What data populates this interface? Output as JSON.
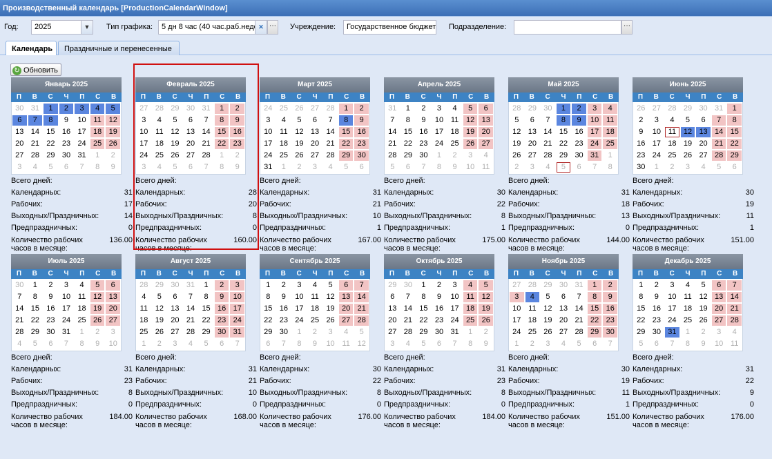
{
  "window": {
    "title": "Производственный календарь [ProductionCalendarWindow]"
  },
  "toolbar": {
    "year_label": "Год:",
    "year_value": "2025",
    "schedule_label": "Тип графика:",
    "schedule_value": "5 дн 8 час (40 час.раб.неде",
    "institution_label": "Учреждение:",
    "institution_value": "Государственное бюджет",
    "division_label": "Подразделение:",
    "division_value": ""
  },
  "tabs": [
    {
      "label": "Календарь",
      "active": true
    },
    {
      "label": "Праздничные и перенесенные дни",
      "active": false
    }
  ],
  "refresh_label": "Обновить",
  "weekdays": [
    "П",
    "В",
    "С",
    "Ч",
    "П",
    "С",
    "В"
  ],
  "stat_labels": {
    "total": "Всего дней:",
    "calendar": "Календарных:",
    "work": "Рабочих:",
    "off": "Выходных/Праздничных:",
    "pre": "Предпраздничных:",
    "hours": "Количество рабочих часов в месяце:"
  },
  "colors": {
    "weekend": "#f2c4c4",
    "selected": "#5b86df",
    "header": "#3d83c4",
    "pre_holiday_border": "#b32b2b"
  },
  "months": [
    {
      "name": "Январь 2025",
      "lead": 2,
      "prev_end": 31,
      "days": 31,
      "weekend": [
        1,
        2,
        3,
        4,
        5,
        6,
        7,
        8,
        11,
        12,
        18,
        19,
        25,
        26
      ],
      "selected": [
        1,
        2,
        3,
        4,
        5,
        6,
        7,
        8
      ],
      "pre": [],
      "calendar": 31,
      "work": 17,
      "off": 14,
      "pre_count": 0,
      "hours": "136.00"
    },
    {
      "name": "Февраль 2025",
      "lead": 5,
      "prev_end": 31,
      "days": 28,
      "weekend": [
        1,
        2,
        8,
        9,
        15,
        16,
        22,
        23
      ],
      "selected": [],
      "pre": [],
      "calendar": 28,
      "work": 20,
      "off": 8,
      "pre_count": 0,
      "hours": "160.00"
    },
    {
      "name": "Март 2025",
      "lead": 5,
      "prev_end": 28,
      "days": 31,
      "weekend": [
        1,
        2,
        8,
        9,
        15,
        16,
        22,
        23,
        29,
        30
      ],
      "selected": [
        8
      ],
      "pre": [],
      "calendar": 31,
      "work": 21,
      "off": 10,
      "pre_count": 1,
      "hours": "167.00"
    },
    {
      "name": "Апрель 2025",
      "lead": 1,
      "prev_end": 31,
      "days": 30,
      "weekend": [
        5,
        6,
        12,
        13,
        19,
        20,
        26,
        27
      ],
      "selected": [],
      "pre": [],
      "calendar": 30,
      "work": 22,
      "off": 8,
      "pre_count": 1,
      "hours": "175.00"
    },
    {
      "name": "Май 2025",
      "lead": 3,
      "prev_end": 30,
      "days": 31,
      "weekend": [
        3,
        4,
        10,
        11,
        17,
        18,
        24,
        25,
        31
      ],
      "selected": [
        1,
        2,
        8,
        9
      ],
      "pre": [],
      "calendar": 31,
      "work": 18,
      "off": 13,
      "pre_count": 0,
      "hours": "144.00"
    },
    {
      "name": "Июнь 2025",
      "lead": 6,
      "prev_end": 31,
      "days": 30,
      "weekend": [
        1,
        7,
        8,
        14,
        15,
        21,
        22,
        28,
        29
      ],
      "selected": [
        12,
        13
      ],
      "pre": [
        11
      ],
      "calendar": 30,
      "work": 19,
      "off": 11,
      "pre_count": 1,
      "hours": "151.00"
    },
    {
      "name": "Июль 2025",
      "lead": 1,
      "prev_end": 30,
      "days": 31,
      "weekend": [
        5,
        6,
        12,
        13,
        19,
        20,
        26,
        27
      ],
      "selected": [],
      "pre": [],
      "calendar": 31,
      "work": 23,
      "off": 8,
      "pre_count": 0,
      "hours": "184.00"
    },
    {
      "name": "Август 2025",
      "lead": 4,
      "prev_end": 31,
      "days": 31,
      "weekend": [
        2,
        3,
        9,
        10,
        16,
        17,
        23,
        24,
        30,
        31
      ],
      "selected": [],
      "pre": [],
      "calendar": 31,
      "work": 21,
      "off": 10,
      "pre_count": 0,
      "hours": "168.00"
    },
    {
      "name": "Сентябрь 2025",
      "lead": 0,
      "prev_end": 31,
      "days": 30,
      "weekend": [
        6,
        7,
        13,
        14,
        20,
        21,
        27,
        28
      ],
      "selected": [],
      "pre": [],
      "calendar": 30,
      "work": 22,
      "off": 8,
      "pre_count": 0,
      "hours": "176.00"
    },
    {
      "name": "Октябрь 2025",
      "lead": 2,
      "prev_end": 30,
      "days": 31,
      "weekend": [
        4,
        5,
        11,
        12,
        18,
        19,
        25,
        26
      ],
      "selected": [],
      "pre": [],
      "calendar": 31,
      "work": 23,
      "off": 8,
      "pre_count": 0,
      "hours": "184.00"
    },
    {
      "name": "Ноябрь 2025",
      "lead": 5,
      "prev_end": 31,
      "days": 30,
      "weekend": [
        1,
        2,
        3,
        8,
        9,
        15,
        16,
        22,
        23,
        29,
        30
      ],
      "selected": [
        4
      ],
      "pre": [],
      "calendar": 30,
      "work": 19,
      "off": 11,
      "pre_count": 1,
      "hours": "151.00"
    },
    {
      "name": "Декабрь 2025",
      "lead": 0,
      "prev_end": 30,
      "days": 31,
      "weekend": [
        6,
        7,
        13,
        14,
        20,
        21,
        27,
        28
      ],
      "selected": [
        31
      ],
      "pre": [],
      "calendar": 31,
      "work": 22,
      "off": 9,
      "pre_count": 0,
      "hours": "176.00"
    }
  ],
  "prev_pre_holiday_marker": {
    "month": 4,
    "day": 5
  }
}
